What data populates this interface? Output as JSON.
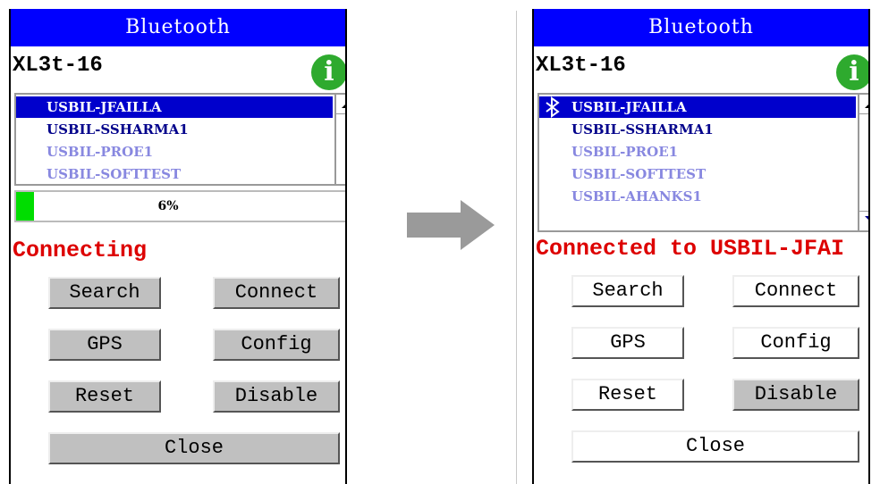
{
  "left": {
    "title": "Bluetooth",
    "device_name": "XL3t-16",
    "devices": [
      "USBIL-JFAILLA",
      "USBIL-SSHARMA1",
      "USBIL-PROE1",
      "USBIL-SOFTTEST"
    ],
    "progress": {
      "percent_label": "6%",
      "value": 0.06
    },
    "status": "Connecting",
    "buttons": {
      "search": "Search",
      "connect": "Connect",
      "gps": "GPS",
      "config": "Config",
      "reset": "Reset",
      "disable": "Disable",
      "close": "Close"
    }
  },
  "right": {
    "title": "Bluetooth",
    "device_name": "XL3t-16",
    "devices": [
      "USBIL-JFAILLA",
      "USBIL-SSHARMA1",
      "USBIL-PROE1",
      "USBIL-SOFTTEST",
      "USBIL-AHANKS1"
    ],
    "status": "Connected to USBIL-JFAI",
    "buttons": {
      "search": "Search",
      "connect": "Connect",
      "gps": "GPS",
      "config": "Config",
      "reset": "Reset",
      "disable": "Disable",
      "close": "Close"
    }
  },
  "colors": {
    "title_bar": "#0000ff",
    "selected_row": "#0000cc",
    "status_text": "#dd0000",
    "progress_fill": "#00dd00",
    "info_icon": "#2eaa2e",
    "button_gray": "#c0c0c0"
  },
  "icons": {
    "info": "info-icon",
    "bluetooth": "bluetooth-icon",
    "scroll_up": "scroll-up-arrow-icon",
    "scroll_down": "scroll-down-arrow-icon",
    "transition": "right-arrow-icon"
  }
}
